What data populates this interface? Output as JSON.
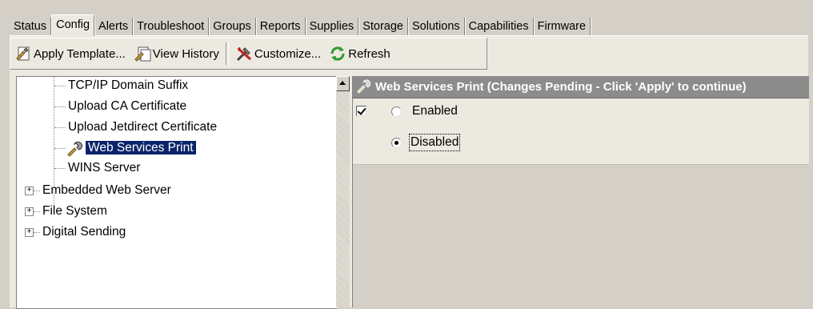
{
  "tabs": [
    {
      "label": "Status"
    },
    {
      "label": "Config"
    },
    {
      "label": "Alerts"
    },
    {
      "label": "Troubleshoot"
    },
    {
      "label": "Groups"
    },
    {
      "label": "Reports"
    },
    {
      "label": "Supplies"
    },
    {
      "label": "Storage"
    },
    {
      "label": "Solutions"
    },
    {
      "label": "Capabilities"
    },
    {
      "label": "Firmware"
    }
  ],
  "active_tab": "Config",
  "toolbar": {
    "apply_template": "Apply Template...",
    "view_history": "View History",
    "customize": "Customize...",
    "refresh": "Refresh"
  },
  "tree": {
    "children": [
      {
        "label": "TCP/IP Domain Suffix"
      },
      {
        "label": "Upload CA Certificate"
      },
      {
        "label": "Upload Jetdirect Certificate"
      },
      {
        "label": "Web Services Print"
      },
      {
        "label": "WINS Server"
      }
    ],
    "groups": [
      {
        "label": "Embedded Web Server"
      },
      {
        "label": "File System"
      },
      {
        "label": "Digital Sending"
      }
    ],
    "selected": "Web Services Print"
  },
  "panel": {
    "title": "Web Services Print (Changes Pending - Click 'Apply' to continue)",
    "options": [
      {
        "label": "Enabled",
        "selected": false
      },
      {
        "label": "Disabled",
        "selected": true
      }
    ],
    "checkbox_checked": true
  },
  "colors": {
    "window_bg": "#d4d0c8",
    "selection": "#0a246a",
    "header_bg": "#8c8c8c"
  }
}
